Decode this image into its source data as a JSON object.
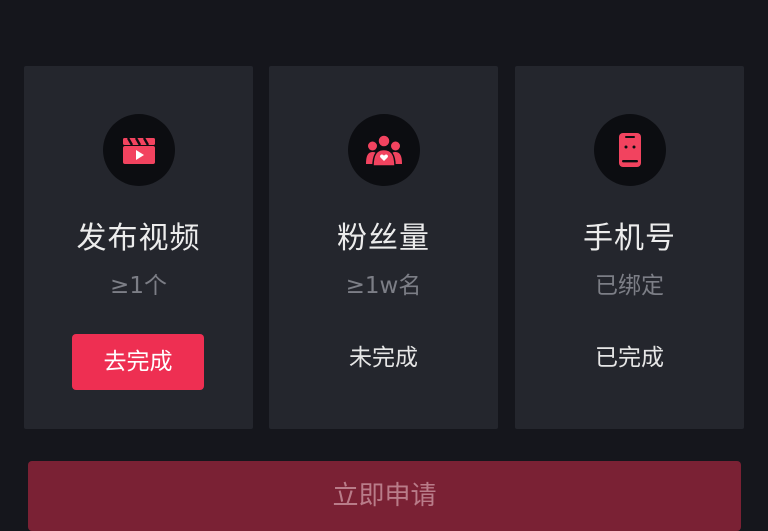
{
  "colors": {
    "background": "#15161c",
    "card_background": "#24262d",
    "accent": "#ee2f52",
    "apply_button_background": "#7a2134",
    "apply_button_text": "#b97c89"
  },
  "requirements": [
    {
      "icon": "video-clapper-icon",
      "title": "发布视频",
      "subtitle": "≥1个",
      "action_label": "去完成"
    },
    {
      "icon": "fans-group-icon",
      "title": "粉丝量",
      "subtitle": "≥1w名",
      "status": "未完成"
    },
    {
      "icon": "phone-icon",
      "title": "手机号",
      "subtitle": "已绑定",
      "status": "已完成"
    }
  ],
  "apply_button_label": "立即申请"
}
